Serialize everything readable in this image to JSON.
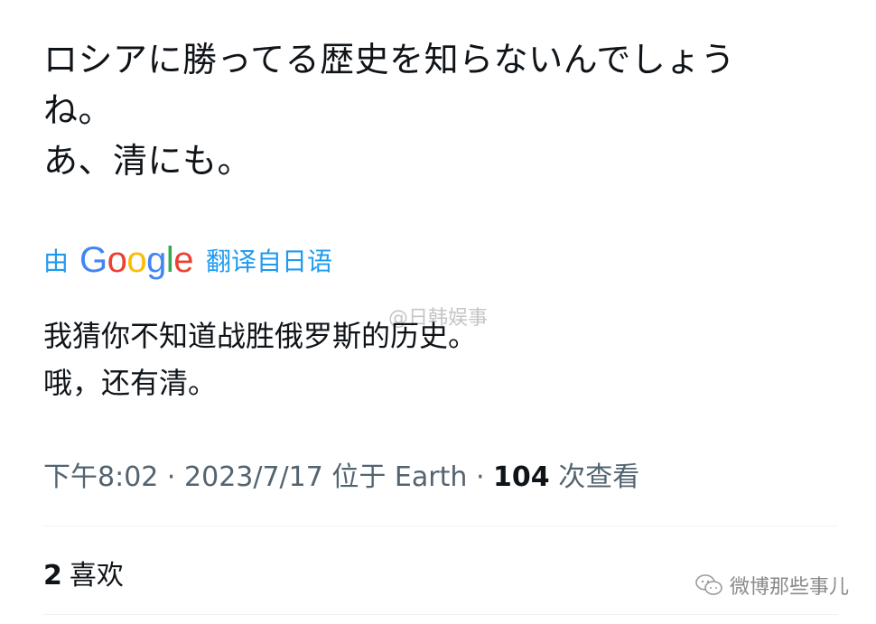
{
  "post": {
    "original_lines": [
      "ロシアに勝ってる歴史を知らないんでしょう",
      "ね。",
      "あ、清にも。"
    ],
    "translation_bar": {
      "prefix": "由",
      "brand": "Google",
      "suffix": "翻译自日语"
    },
    "translated_lines": [
      "我猜你不知道战胜俄罗斯的历史。",
      "哦，还有清。"
    ],
    "meta": {
      "time": "下午8:02",
      "separator": "·",
      "date": "2023/7/17",
      "location": "位于 Earth",
      "views_count": "104",
      "views_label": "次查看"
    },
    "likes": {
      "count": "2",
      "label": "喜欢"
    }
  },
  "watermarks": {
    "top": "@日韩娱事",
    "bottom": "微博那些事儿"
  },
  "colors": {
    "text": "#0f1419",
    "muted": "#536471",
    "link": "#1d9bf0"
  }
}
